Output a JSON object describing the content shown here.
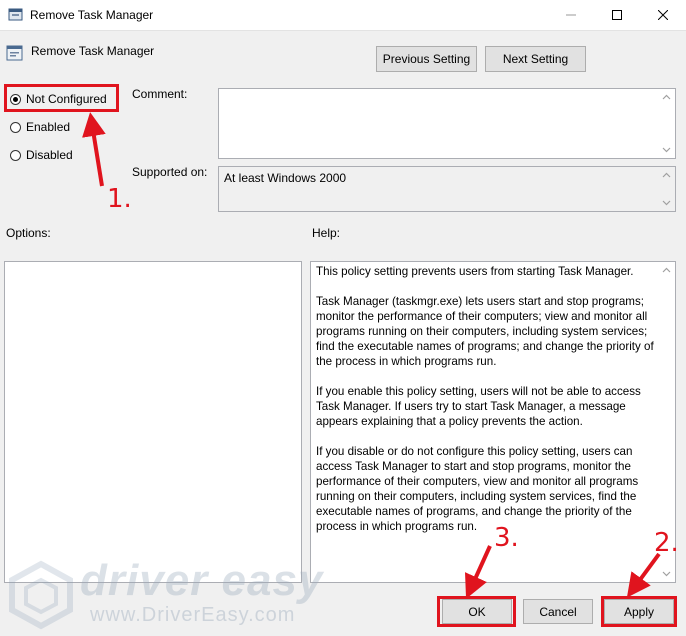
{
  "window": {
    "title": "Remove Task Manager",
    "icon": "policy-icon",
    "controls": [
      "minimize-icon",
      "maximize-icon",
      "close-icon"
    ]
  },
  "header": {
    "setting_name": "Remove Task Manager",
    "previous_label": "Previous Setting",
    "next_label": "Next Setting"
  },
  "state": {
    "options": [
      {
        "label": "Not Configured",
        "selected": true
      },
      {
        "label": "Enabled",
        "selected": false
      },
      {
        "label": "Disabled",
        "selected": false
      }
    ]
  },
  "comment": {
    "label": "Comment:",
    "value": ""
  },
  "supported": {
    "label": "Supported on:",
    "value": "At least Windows 2000"
  },
  "options_panel": {
    "label": "Options:"
  },
  "help": {
    "label": "Help:",
    "paragraphs": [
      "This policy setting prevents users from starting Task Manager.",
      "Task Manager (taskmgr.exe) lets users start and stop programs; monitor the performance of their computers; view and monitor all programs running on their computers, including system services; find the executable names of programs; and change the priority of the process in which programs run.",
      "If you enable this policy setting, users will not be able to access Task Manager. If users try to start Task Manager, a message appears explaining that a policy prevents the action.",
      "If you disable or do not configure this policy setting, users can access Task Manager to  start and stop programs, monitor the performance of their computers, view and monitor all programs running on their computers, including system services, find the executable names of programs, and change the priority of the process in which programs run."
    ]
  },
  "footer": {
    "ok_label": "OK",
    "cancel_label": "Cancel",
    "apply_label": "Apply"
  },
  "annotations": {
    "step1": "1.",
    "step2": "2.",
    "step3": "3.",
    "color": "#e0141e"
  },
  "watermark": {
    "brand": "driver easy",
    "url": "www.DriverEasy.com"
  }
}
